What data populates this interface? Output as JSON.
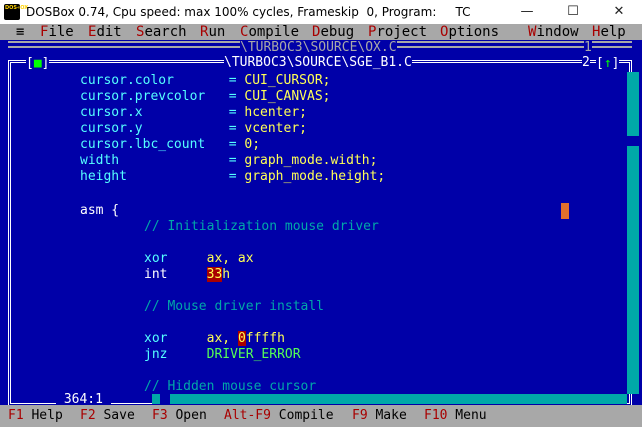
{
  "window": {
    "title": "DOSBox 0.74, Cpu speed: max 100% cycles, Frameskip  0, Program:     TC",
    "minimize": "—",
    "maximize": "☐",
    "close": "✕"
  },
  "menu": {
    "system": "≡",
    "file": [
      "F",
      "ile"
    ],
    "edit": [
      "E",
      "dit"
    ],
    "search": [
      "S",
      "earch"
    ],
    "run": [
      "R",
      "un"
    ],
    "compile": [
      "C",
      "ompile"
    ],
    "debug": [
      "D",
      "ebug"
    ],
    "project": [
      "P",
      "roject"
    ],
    "options": [
      "O",
      "ptions"
    ],
    "window": [
      "W",
      "indow"
    ],
    "help": [
      "H",
      "elp"
    ]
  },
  "back_window": {
    "title": "\\TURBOC3\\SOURCE\\OX.C",
    "number": "1"
  },
  "front_window": {
    "title": "\\TURBOC3\\SOURCE\\SGE_B1.C",
    "close": [
      "[",
      "■",
      "]"
    ],
    "number": "2",
    "zoom": [
      "[",
      "↑",
      "]"
    ],
    "cursor_pos": " 364:1 "
  },
  "code": {
    "l1": [
      "cursor.color       ",
      "= ",
      "CUI_CURSOR;"
    ],
    "l2": [
      "cursor.prevcolor   ",
      "= ",
      "CUI_CANVAS;"
    ],
    "l3": [
      "cursor.x           ",
      "= ",
      "hcenter;"
    ],
    "l4": [
      "cursor.y           ",
      "= ",
      "vcenter;"
    ],
    "l5": [
      "cursor.lbc_count   ",
      "= ",
      "0;"
    ],
    "l6": [
      "width              ",
      "= ",
      "graph_mode.width;"
    ],
    "l7": [
      "height             ",
      "= ",
      "graph_mode.height;"
    ],
    "l8": [
      "asm {"
    ],
    "l9": "// Initialization mouse driver",
    "l10": [
      "xor     ",
      "ax, ax"
    ],
    "l11": [
      "int     ",
      "33",
      "h"
    ],
    "l12": "// Mouse driver install",
    "l13": [
      "xor     ",
      "ax, ",
      "0",
      "ffffh"
    ],
    "l14": [
      "jnz     ",
      "DRIVER_ERROR"
    ],
    "l15": "// Hidden mouse cursor"
  },
  "status": {
    "f1": [
      "F1",
      " Help"
    ],
    "f2": [
      "F2",
      " Save"
    ],
    "f3": [
      "F3",
      " Open"
    ],
    "altf9": [
      "Alt-F9",
      " Compile"
    ],
    "f9": [
      "F9",
      " Make"
    ],
    "f10": [
      "F10",
      " Menu"
    ]
  },
  "colors": {
    "screen_bg": "#0000a8",
    "menu_bg": "#a8a8a8",
    "hotkey": "#a80000",
    "code_text": "#55ffff",
    "code_literal": "#ffff55",
    "comment": "#00a8a8",
    "highlight_bg": "#a80000"
  }
}
